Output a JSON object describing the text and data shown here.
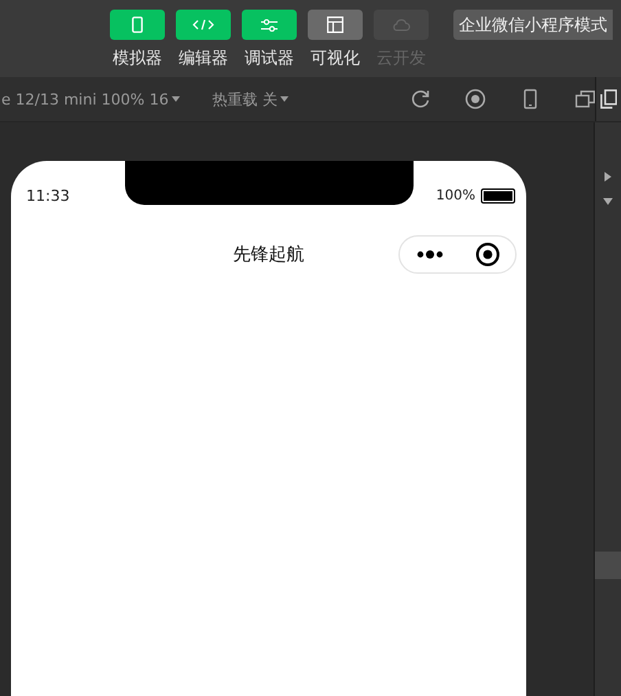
{
  "toolbar": {
    "tools": [
      {
        "label": "模拟器",
        "kind": "phone",
        "on": true,
        "disabled": false
      },
      {
        "label": "编辑器",
        "kind": "code",
        "on": true,
        "disabled": false
      },
      {
        "label": "调试器",
        "kind": "sliders",
        "on": true,
        "disabled": false
      },
      {
        "label": "可视化",
        "kind": "layout",
        "on": false,
        "disabled": false
      },
      {
        "label": "云开发",
        "kind": "cloud",
        "on": false,
        "disabled": true
      }
    ],
    "mode_button": "企业微信小程序模式"
  },
  "simulator_bar": {
    "device": "e 12/13 mini 100% 16",
    "hot_reload": "热重载 关"
  },
  "phone": {
    "time": "11:33",
    "battery_text": "100%",
    "title": "先锋起航"
  }
}
